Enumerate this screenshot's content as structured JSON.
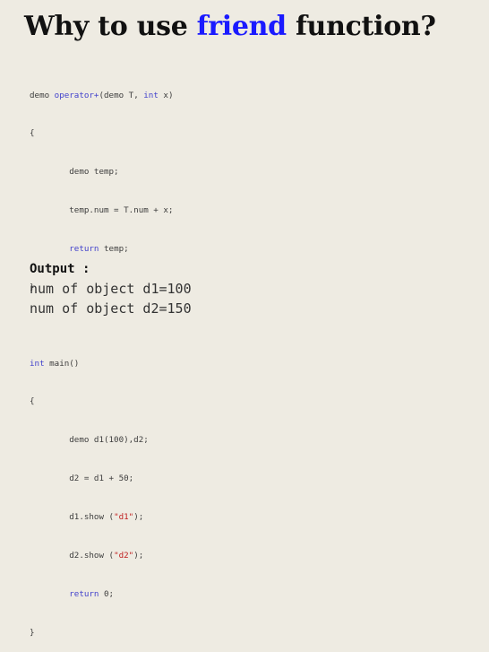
{
  "title": {
    "prefix": "Why to use ",
    "keyword": "friend",
    "suffix": " function?"
  },
  "code": {
    "operator_fn": {
      "ret_type": "demo ",
      "name": "operator+",
      "args_open": "(demo T, ",
      "arg2_type": "int",
      "args_close": " x)",
      "open_brace": "{",
      "decl": "demo temp;",
      "assign": "temp.num = T.num + x;",
      "return_kw": "return",
      "return_val": " temp;",
      "close_brace": "}"
    },
    "main_fn": {
      "ret_type": "int",
      "name": " main()",
      "open_brace": "{",
      "decl": "demo d1(100),d2;",
      "assign": "d2 = d1 + 50;",
      "show1_pre": "d1.show (",
      "show1_str": "\"d1\"",
      "show1_post": ");",
      "show2_pre": "d2.show (",
      "show2_str": "\"d2\"",
      "show2_post": ");",
      "return_kw": "return",
      "return_val": " 0;",
      "close_brace": "}"
    }
  },
  "output": {
    "label": "Output :",
    "lines": [
      "num of object d1=100",
      "num of object d2=150"
    ]
  },
  "colors": {
    "background": "#eeebe2",
    "title_keyword": "#1a1aff",
    "code_keyword": "#4242cc",
    "code_string": "#c02020"
  }
}
